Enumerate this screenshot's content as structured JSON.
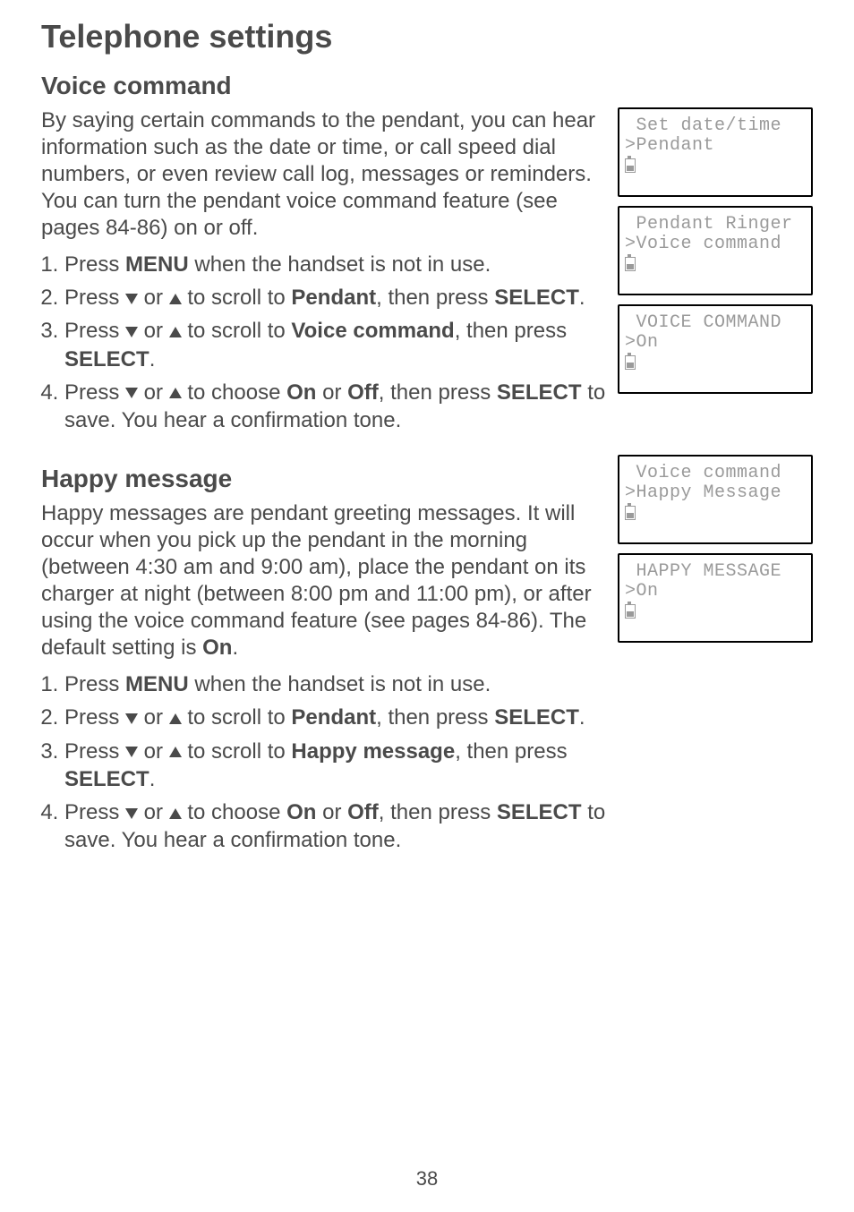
{
  "page": {
    "title": "Telephone settings",
    "number": "38"
  },
  "voice_command": {
    "heading": "Voice command",
    "intro": "By saying certain commands to the pendant, you can hear information such as the date or time, or call speed dial numbers, or even review call log, messages or reminders. You can turn the pendant voice command feature (see pages 84-86) on or off.",
    "step1_p1": "Press ",
    "step1_b1": "MENU",
    "step1_p2": " when the handset is not in use.",
    "step2_p1": "Press ",
    "step2_p2": " or ",
    "step2_p3": " to scroll to ",
    "step2_b1": "Pendant",
    "step2_p4": ", then press ",
    "step2_b2": "SELECT",
    "step2_p5": ".",
    "step3_p1": "Press ",
    "step3_p2": " or ",
    "step3_p3": " to scroll to ",
    "step3_b1": "Voice command",
    "step3_p4": ", then press ",
    "step3_b2": "SELECT",
    "step3_p5": ".",
    "step4_p1": "Press ",
    "step4_p2": " or ",
    "step4_p3": " to choose ",
    "step4_b1": "On",
    "step4_p4": " or ",
    "step4_b2": "Off",
    "step4_p5": ", then press ",
    "step4_b3": "SELECT",
    "step4_p6": " to save. You hear a confirmation tone."
  },
  "happy_message": {
    "heading": "Happy message",
    "intro_p1": "Happy messages are pendant greeting messages. It will occur when you pick up the pendant in the morning (between 4:30 am and 9:00 am), place the pendant on its charger at night (between 8:00 pm and 11:00 pm), or after using the voice command feature (see pages 84-86). The default setting is ",
    "intro_b1": "On",
    "intro_p2": ".",
    "step1_p1": "Press ",
    "step1_b1": "MENU",
    "step1_p2": " when the handset is not in use.",
    "step2_p1": "Press ",
    "step2_p2": " or ",
    "step2_p3": " to scroll to ",
    "step2_b1": "Pendant",
    "step2_p4": ", then press ",
    "step2_b2": "SELECT",
    "step2_p5": ".",
    "step3_p1": "Press ",
    "step3_p2": " or ",
    "step3_p3": " to scroll to ",
    "step3_b1": "Happy message",
    "step3_p4": ", then press ",
    "step3_b2": "SELECT",
    "step3_p5": ".",
    "step4_p1": "Press ",
    "step4_p2": " or ",
    "step4_p3": " to choose ",
    "step4_b1": "On",
    "step4_p4": " or ",
    "step4_b2": "Off",
    "step4_p5": ", then press ",
    "step4_b3": "SELECT",
    "step4_p6": " to save. You hear a confirmation tone."
  },
  "lcd": {
    "s1_l1": " Set date/time",
    "s1_l2": ">Pendant",
    "s2_l1": " Pendant Ringer",
    "s2_l2": ">Voice command",
    "s3_l1": " VOICE COMMAND",
    "s3_l2": ">On",
    "s4_l1": " Voice command",
    "s4_l2": ">Happy Message",
    "s5_l1": " HAPPY MESSAGE",
    "s5_l2": ">On"
  }
}
